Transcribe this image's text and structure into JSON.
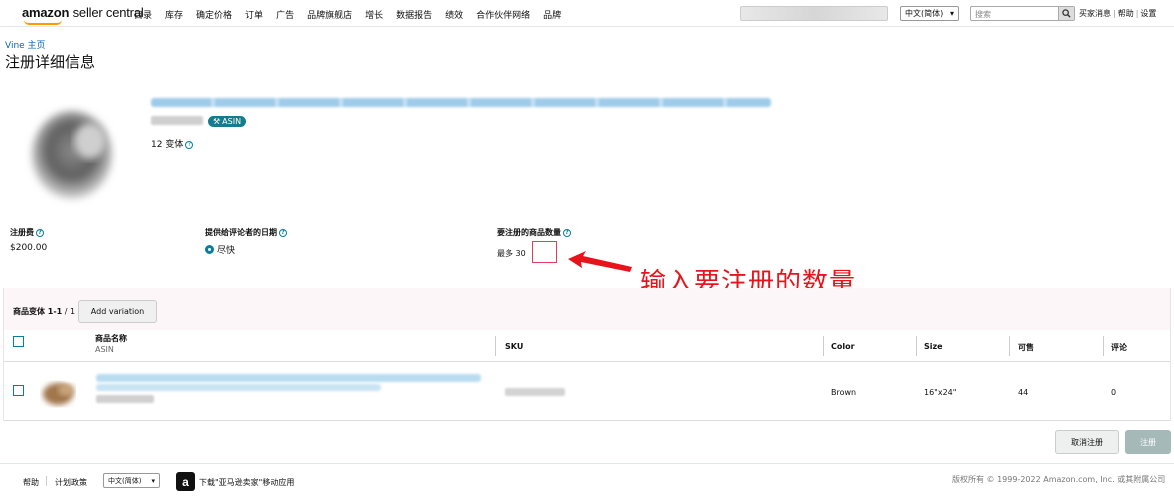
{
  "nav": {
    "logo_bold": "amazon",
    "logo_light": " seller central",
    "items": [
      "目录",
      "库存",
      "确定价格",
      "订单",
      "广告",
      "品牌旗舰店",
      "增长",
      "数据报告",
      "绩效",
      "合作伙伴网络",
      "品牌"
    ],
    "language": "中文(简体)",
    "search_placeholder": "搜索",
    "links": [
      "买家消息",
      "帮助",
      "设置"
    ]
  },
  "header": {
    "breadcrumb": "Vine 主页",
    "title": "注册详细信息"
  },
  "product": {
    "asin_badge": "ASIN",
    "variants": "12 变体"
  },
  "fields": {
    "fee_label": "注册费",
    "fee_value": "$200.00",
    "date_label": "提供给评论者的日期",
    "date_value": "尽快",
    "qty_label": "要注册的商品数量",
    "qty_max": "最多 30"
  },
  "annotation": "输入要注册的数量",
  "variations": {
    "count_label": "商品变体",
    "count_value": "1-1",
    "count_total": " / 1",
    "add_button": "Add variation",
    "columns": {
      "name": "商品名称",
      "asin": "ASIN",
      "sku": "SKU",
      "color": "Color",
      "size": "Size",
      "available": "可售",
      "reviews": "评论"
    },
    "rows": [
      {
        "color": "Brown",
        "size": "16\"x24\"",
        "available": "44",
        "reviews": "0"
      }
    ]
  },
  "buttons": {
    "cancel": "取消注册",
    "register": "注册"
  },
  "footer": {
    "help": "帮助",
    "policy": "计划政策",
    "language": "中文(简体)",
    "app_icon": "a",
    "app_text": "下载\"亚马逊卖家\"移动应用",
    "copyright": "版权所有 © 1999-2022 Amazon.com, Inc. 或其附属公司"
  },
  "colors": {
    "accent": "#0a7c9e",
    "annotation": "#e8141c",
    "badge": "#147c8e"
  }
}
